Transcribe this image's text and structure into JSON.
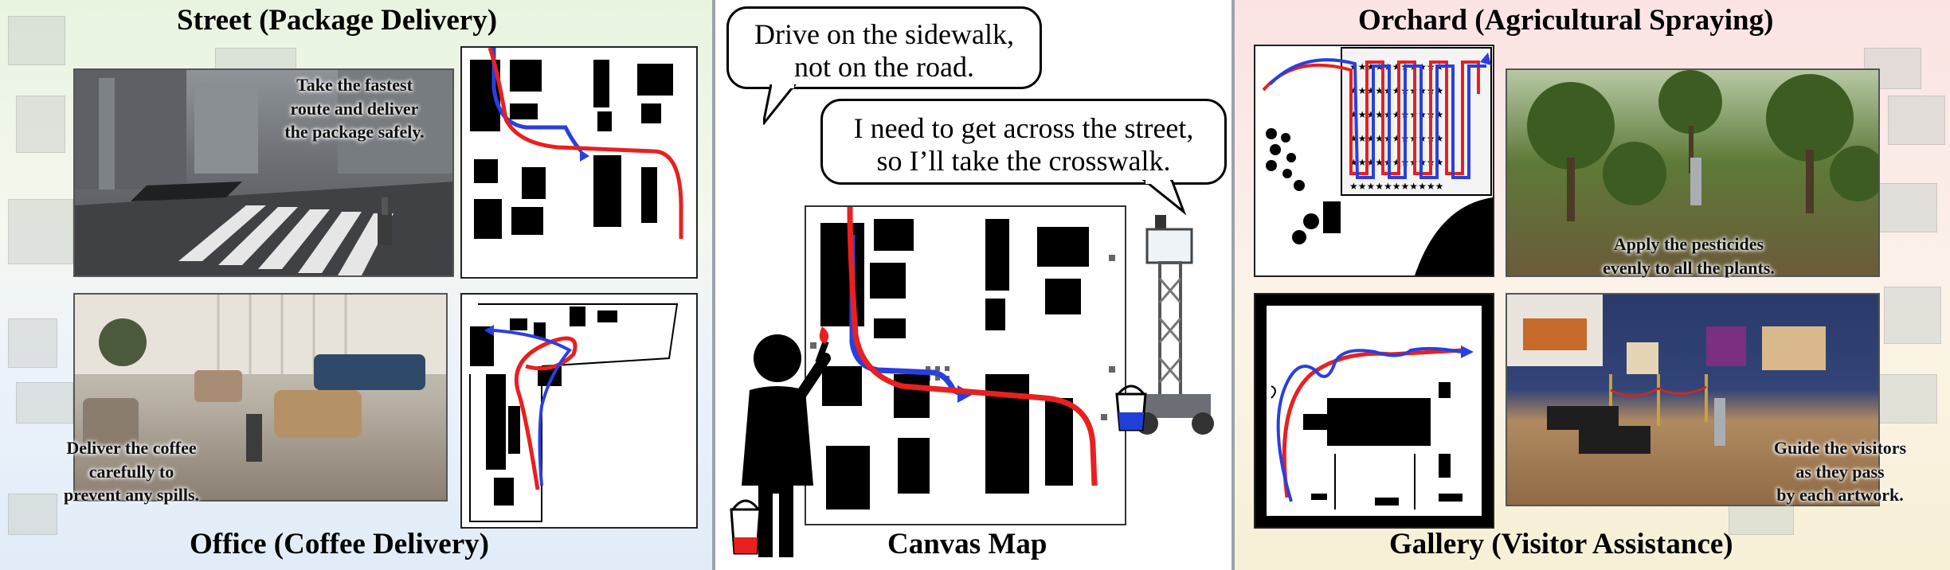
{
  "panels": {
    "street": {
      "title": "Street (Package Delivery)",
      "caption": [
        "Take the fastest",
        "route and deliver",
        "the package safely."
      ]
    },
    "office": {
      "title": "Office (Coffee Delivery)",
      "caption": [
        "Deliver the coffee",
        "carefully to",
        "prevent any spills."
      ]
    },
    "canvas": {
      "title": "Canvas Map",
      "bubble_left": [
        "Drive on the sidewalk,",
        "not on the road."
      ],
      "bubble_right": [
        "I need to get across the street,",
        "so I’ll take the crosswalk."
      ]
    },
    "orchard": {
      "title": "Orchard (Agricultural Spraying)",
      "caption": [
        "Apply the pesticides",
        "evenly to all the plants."
      ]
    },
    "gallery": {
      "title": "Gallery (Visitor Assistance)",
      "caption": [
        "Guide the visitors",
        "as they pass",
        "by each artwork."
      ]
    }
  },
  "colors": {
    "path_red": "#e82020",
    "path_blue": "#2a3fe0",
    "divider": "#9aa3ab"
  },
  "icons": [
    "person-painter-icon",
    "paint-bucket-icon",
    "robot-icon",
    "paintbrush-icon"
  ]
}
